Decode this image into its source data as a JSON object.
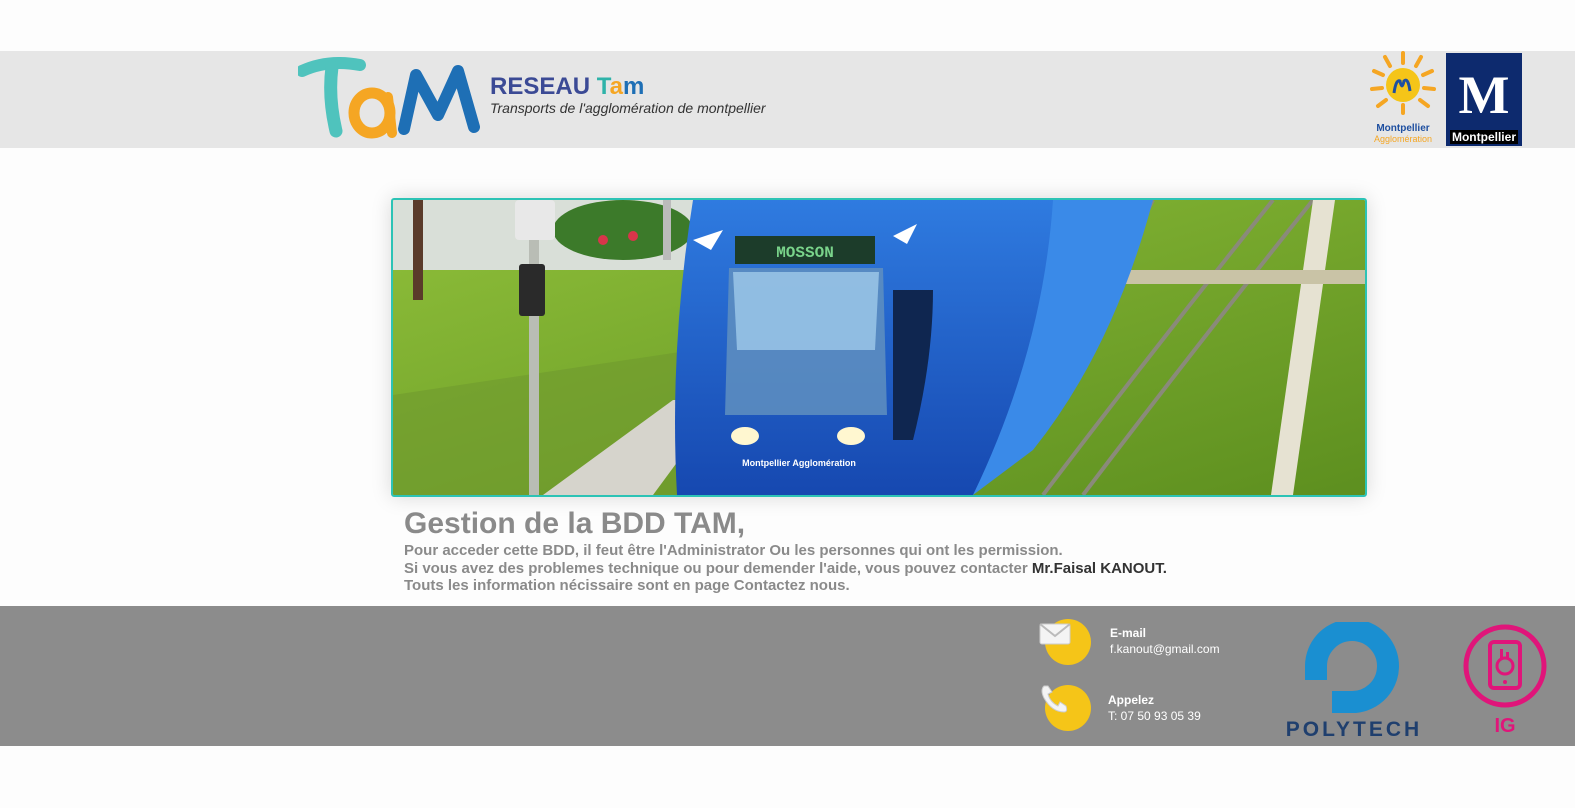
{
  "header": {
    "title_prefix": "RESEAU ",
    "title_t": "T",
    "title_a": "a",
    "title_m": "m",
    "subtitle": "Transports de l'agglomération de montpellier",
    "agglo_logo_line1": "Montpellier",
    "agglo_logo_line2": "Agglomération",
    "city_logo_letter": "M",
    "city_logo_label": "Montpellier"
  },
  "hero": {
    "tram_destination": "MOSSON",
    "tram_livery": "Montpellier Agglomération"
  },
  "main": {
    "title": "Gestion de la BDD TAM,",
    "line1": "Pour acceder cette BDD, il feut être l'Administrator Ou les personnes qui ont les permission.",
    "line2_prefix": "Si vous avez des problemes technique ou pour demender l'aide, vous pouvez contacter ",
    "contact_name": "Mr.Faisal KANOUT",
    "line2_suffix": ".",
    "line3": "Touts les information nécissaire sont en page Contactez nous."
  },
  "footer": {
    "email_label": "E-mail",
    "email_value": "f.kanout@gmail.com",
    "phone_label": "Appelez",
    "phone_value": "T: 07 50 93 05 39",
    "polytech_label": "POLYTECH",
    "ig_label": "IG"
  },
  "colors": {
    "accent_teal": "#2cc3b5",
    "header_bg": "#e6e6e6",
    "footer_bg": "#8c8c8c",
    "icon_yellow": "#f5c518",
    "polytech_blue": "#1a8fd1",
    "ig_pink": "#e0157a"
  },
  "icons": [
    "tam-logo",
    "montpellier-agglomeration-logo",
    "montpellier-city-logo",
    "envelope-icon",
    "phone-icon",
    "polytech-logo",
    "ig-logo"
  ]
}
